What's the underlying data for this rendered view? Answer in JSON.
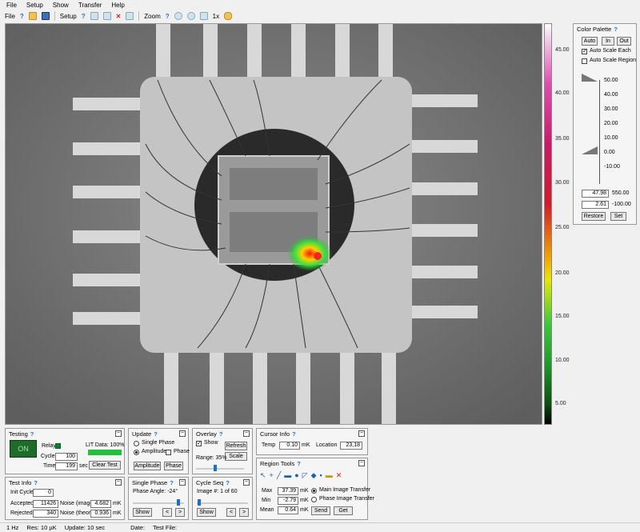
{
  "menu": [
    "File",
    "Setup",
    "Show",
    "Transfer",
    "Help"
  ],
  "toolbar": {
    "file": "File",
    "setup": "Setup",
    "zoom": "Zoom",
    "zoom_level": "1x"
  },
  "scale": {
    "labels": [
      "45.00",
      "40.00",
      "35.00",
      "30.00",
      "25.00",
      "20.00",
      "15.00",
      "10.00",
      "5.00"
    ]
  },
  "palette": {
    "title": "Color Palette",
    "auto": "Auto",
    "in": "In",
    "out": "Out",
    "auto_scale_each": "Auto Scale Each",
    "auto_scale_region": "Auto Scale Region",
    "ticks": [
      "50.00",
      "40.00",
      "30.00",
      "20.00",
      "10.00",
      "0.00",
      "-10.00"
    ],
    "max_value": "47.98",
    "max_limit": "550.00",
    "min_value": "2.61",
    "min_limit": "-100.00",
    "restore": "Restore",
    "set": "Set"
  },
  "testing": {
    "title": "Testing",
    "on": "ON",
    "relay": "Relay",
    "lit_data": "LIT Data: 100%",
    "cycles_label": "Cycles",
    "cycles": "100",
    "time_label": "Time",
    "time": "199",
    "time_unit": "sec",
    "clear_test": "Clear Test"
  },
  "update": {
    "title": "Update",
    "single_phase": "Single Phase",
    "amplitude": "Amplitude",
    "phase_chk": "Phase",
    "amplitude_btn": "Amplitude",
    "phase_btn": "Phase"
  },
  "overlay": {
    "title": "Overlay",
    "show": "Show",
    "refresh": "Refresh",
    "scale": "Scale",
    "range": "Range: 35%"
  },
  "cursor_info": {
    "title": "Cursor Info",
    "temp_label": "Temp",
    "temp": "0.10",
    "unit": "mK",
    "location_label": "Location",
    "location": "23,18"
  },
  "region_tools": {
    "title": "Region Tools",
    "max_label": "Max",
    "max": "37.39",
    "min_label": "Min",
    "min": "-2.79",
    "mean_label": "Mean",
    "mean": "0.64",
    "unit": "mK",
    "main_transfer": "Main Image Transfer",
    "phase_transfer": "Phase Image Transfer",
    "send": "Send",
    "get": "Get"
  },
  "test_info": {
    "title": "Test Info",
    "init_cycles_label": "Init Cycles",
    "init_cycles": "0",
    "accepted_label": "Accepted",
    "accepted": "11426",
    "rejected_label": "Rejected",
    "rejected": "340",
    "noise_image_label": "Noise (image)",
    "noise_image": "4.682",
    "noise_theory_label": "Noise (theory)",
    "noise_theory": "0.936",
    "unit": "mK"
  },
  "single_phase": {
    "title": "Single Phase",
    "phase_angle": "Phase Angle: -24°",
    "show": "Show",
    "prev": "<",
    "next": ">"
  },
  "cycle_seq": {
    "title": "Cycle Seq",
    "image_num": "Image #: 1 of 60",
    "show": "Show",
    "prev": "<",
    "next": ">"
  },
  "status": {
    "freq": "1 Hz",
    "res": "Res:  10 µK",
    "update": "Update:  10 sec",
    "date": "Date:",
    "test_file": "Test File:"
  }
}
